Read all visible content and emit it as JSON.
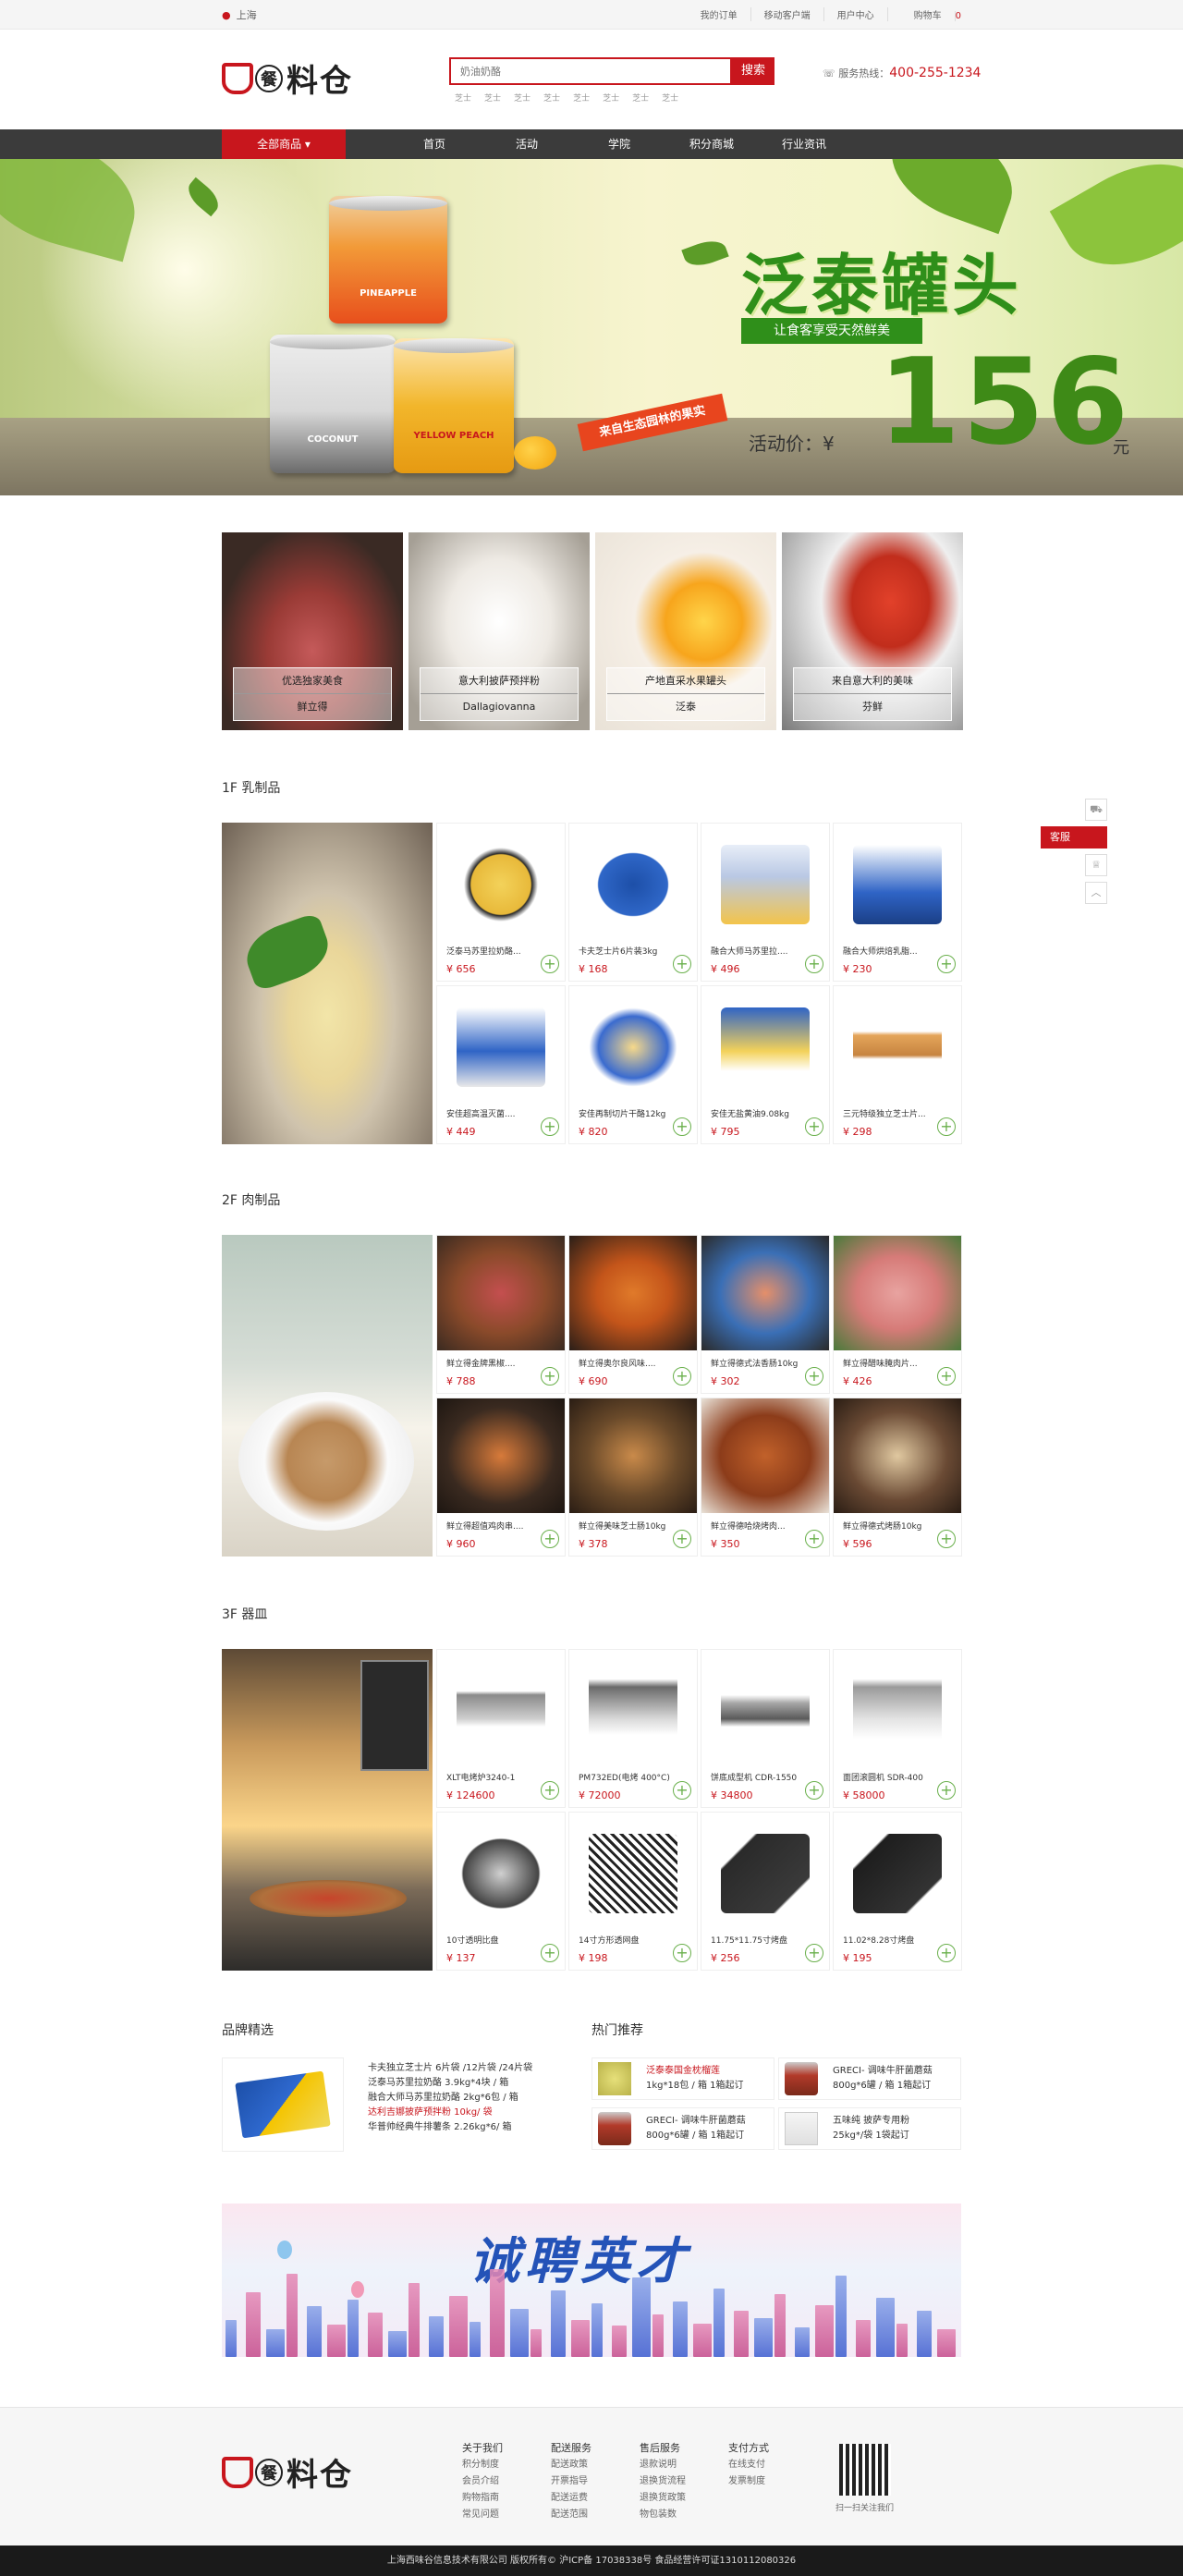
{
  "topbar": {
    "location": "上海",
    "links": [
      "我的订单",
      "移动客户端",
      "用户中心"
    ],
    "cart_label": "购物车",
    "cart_count": "0"
  },
  "header": {
    "logo_char": "餐",
    "logo_text": "料仓",
    "search_placeholder": "奶油奶酪",
    "search_button": "搜索",
    "hotwords": [
      "芝士",
      "芝士",
      "芝士",
      "芝士",
      "芝士",
      "芝士",
      "芝士",
      "芝士"
    ],
    "hotline_label": "服务热线：",
    "hotline": "400-255-1234"
  },
  "nav": {
    "all_label": "全部商品",
    "items": [
      "首页",
      "活动",
      "学院",
      "积分商城",
      "行业资讯"
    ]
  },
  "banner": {
    "title": "泛泰罐头",
    "tagline": "让食客享受天然鲜美",
    "ribbon": "来自生态园林的果实",
    "price_label": "活动价：",
    "currency": "¥",
    "price": "156",
    "unit": "元",
    "can_labels": [
      "PINEAPPLE",
      "COCONUT",
      "YELLOW PEACH"
    ]
  },
  "featured": [
    {
      "title": "优选独家美食",
      "brand": "鲜立得"
    },
    {
      "title": "意大利披萨预拌粉",
      "brand": "Dallagiovanna"
    },
    {
      "title": "产地直采水果罐头",
      "brand": "泛泰"
    },
    {
      "title": "来自意大利的美味",
      "brand": "芬鲜"
    }
  ],
  "floors": [
    {
      "title": "1F 乳制品",
      "products": [
        {
          "name": "泛泰马苏里拉奶酪...",
          "price": "¥ 656"
        },
        {
          "name": "卡夫芝士片6片装3kg",
          "price": "¥ 168"
        },
        {
          "name": "融合大师马苏里拉....",
          "price": "¥ 496"
        },
        {
          "name": "融合大师烘焙乳脂...",
          "price": "¥ 230"
        },
        {
          "name": "安佳超高温灭菌....",
          "price": "¥ 449"
        },
        {
          "name": "安佳再制切片干酪12kg",
          "price": "¥ 820"
        },
        {
          "name": "安佳无盐黄油9.08kg",
          "price": "¥ 795"
        },
        {
          "name": "三元特级独立芝士片...",
          "price": "¥ 298"
        }
      ]
    },
    {
      "title": "2F 肉制品",
      "products": [
        {
          "name": "鲜立得金牌黑椒....",
          "price": "¥ 788"
        },
        {
          "name": "鲜立得奥尔良风味....",
          "price": "¥ 690"
        },
        {
          "name": "鲜立得德式法香肠10kg",
          "price": "¥ 302"
        },
        {
          "name": "鲜立得醋味腌肉片...",
          "price": "¥ 426"
        },
        {
          "name": "鲜立得超值鸡肉串....",
          "price": "¥ 960"
        },
        {
          "name": "鲜立得美味芝士肠10kg",
          "price": "¥ 378"
        },
        {
          "name": "鲜立得德哈烧烤肉...",
          "price": "¥ 350"
        },
        {
          "name": "鲜立得德式烤肠10kg",
          "price": "¥ 596"
        }
      ]
    },
    {
      "title": "3F 器皿",
      "products": [
        {
          "name": "XLT电烤炉3240-1",
          "price": "¥ 124600"
        },
        {
          "name": "PM732ED(电烤 400°C)",
          "price": "¥ 72000"
        },
        {
          "name": "饼底成型机 CDR-1550",
          "price": "¥ 34800"
        },
        {
          "name": "面团滚圆机 SDR-400",
          "price": "¥ 58000"
        },
        {
          "name": "10寸透明比盘",
          "price": "¥ 137"
        },
        {
          "name": "14寸方形透网盘",
          "price": "¥ 198"
        },
        {
          "name": "11.75*11.75寸烤盘",
          "price": "¥ 256"
        },
        {
          "name": "11.02*8.28寸烤盘",
          "price": "¥ 195"
        }
      ]
    }
  ],
  "brands": {
    "title": "品牌精选",
    "lines": [
      "卡夫独立芝士片  6片袋 /12片袋 /24片袋",
      "泛泰马苏里拉奶酪  3.9kg*4块 / 箱",
      "融合大师马苏里拉奶酪  2kg*6包 / 箱",
      "达利吉娜披萨预拌粉  10kg/ 袋",
      "华普帅经典牛排薯条  2.26kg*6/ 箱"
    ]
  },
  "hot": {
    "title": "热门推荐",
    "items": [
      {
        "l1": "泛泰泰国金枕榴莲",
        "l2": "1kg*18包 / 箱    1箱起订"
      },
      {
        "l1": "GRECI- 调味牛肝菌蘑菇",
        "l2": "800g*6罐 / 箱    1箱起订"
      },
      {
        "l1": "GRECI- 调味牛肝菌蘑菇",
        "l2": "800g*6罐 / 箱    1箱起订"
      },
      {
        "l1": "五味纯  披萨专用粉",
        "l2": "25kg*/袋    1袋起订"
      }
    ]
  },
  "recruit": {
    "text": "诚聘英才"
  },
  "footer": {
    "cols": [
      {
        "h": "关于我们",
        "items": [
          "积分制度",
          "会员介绍",
          "购物指南",
          "常见问题"
        ]
      },
      {
        "h": "配送服务",
        "items": [
          "配送政策",
          "开票指导",
          "配送运费",
          "配送范围"
        ]
      },
      {
        "h": "售后服务",
        "items": [
          "退款说明",
          "退换货流程",
          "退换货政策",
          "物包装数"
        ]
      },
      {
        "h": "支付方式",
        "items": [
          "在线支付",
          "发票制度"
        ]
      }
    ],
    "qr_label": "扫一扫关注我们",
    "copyright": "上海西味谷信息技术有限公司  版权所有© 沪ICP备 17038338号  食品经营许可证1310112080326"
  },
  "side": {
    "service": "客服"
  },
  "colors": {
    "brand_red": "#c8161d",
    "nav_dark": "#3b3b3b",
    "banner_green": "#2f8f1a"
  }
}
